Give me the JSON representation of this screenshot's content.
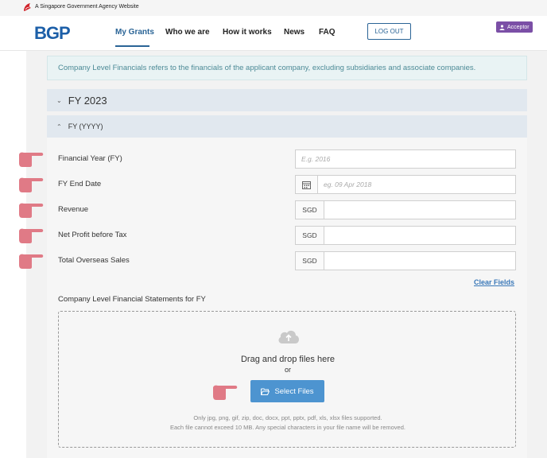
{
  "gov_banner": {
    "text": "A Singapore Government Agency Website"
  },
  "header": {
    "logo": "BGP",
    "nav": [
      {
        "label": "My Grants",
        "active": true
      },
      {
        "label": "Who we are"
      },
      {
        "label": "How it works"
      },
      {
        "label": "News"
      },
      {
        "label": "FAQ"
      }
    ],
    "logout_label": "LOG OUT",
    "role_label": "Acceptor"
  },
  "info_note": "Company Level Financials refers to the financials of the applicant company, excluding subsidiaries and associate companies.",
  "sections": {
    "fy_2023": "FY 2023",
    "fy_yyyy": "FY (YYYY)"
  },
  "form": {
    "financial_year": {
      "label": "Financial Year (FY)",
      "placeholder": "E.g. 2016"
    },
    "fy_end_date": {
      "label": "FY End Date",
      "placeholder": "eg. 09 Apr 2018"
    },
    "revenue": {
      "label": "Revenue",
      "prefix": "SGD"
    },
    "net_profit": {
      "label": "Net Profit before Tax",
      "prefix": "SGD"
    },
    "overseas_sales": {
      "label": "Total Overseas Sales",
      "prefix": "SGD"
    },
    "clear_label": "Clear Fields"
  },
  "upload": {
    "label": "Company Level Financial Statements for FY",
    "title": "Drag and drop files here",
    "or": "or",
    "button_label": "Select Files",
    "note1": "Only jpg, png, gif, zip, doc, docx, ppt, pptx, pdf, xls, xlsx files supported.",
    "note2": "Each file cannot exceed 10 MB. Any special characters in your file name will be removed."
  },
  "colors": {
    "brand": "#1c5fa8",
    "accent_button": "#4d94d0",
    "role_badge": "#7b4fa6",
    "pointer": "#e07a86"
  }
}
